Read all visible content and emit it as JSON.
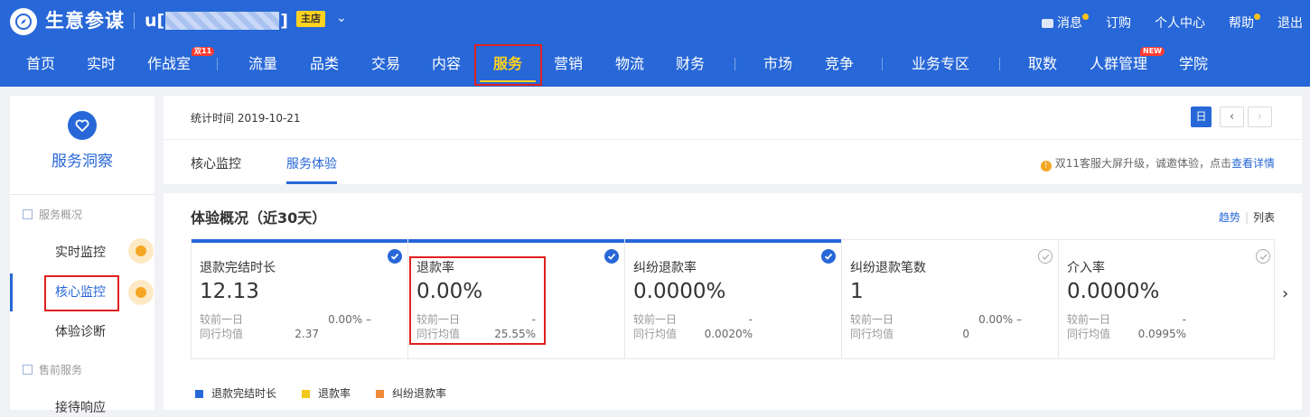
{
  "header": {
    "brand": "生意参谋",
    "shop_prefix": "u[",
    "shop_suffix": "]",
    "main_badge": "主店",
    "links": [
      "消息",
      "订购",
      "个人中心",
      "帮助",
      "退出"
    ]
  },
  "nav": {
    "items": [
      "首页",
      "实时",
      "作战室",
      "流量",
      "品类",
      "交易",
      "内容",
      "服务",
      "营销",
      "物流",
      "财务",
      "市场",
      "竞争",
      "业务专区",
      "取数",
      "人群管理",
      "学院"
    ],
    "active": "服务",
    "tag_double11": "双11",
    "tag_new": "NEW"
  },
  "sidebar": {
    "title": "服务洞察",
    "section1": "服务概况",
    "items1": [
      "实时监控",
      "核心监控",
      "体验诊断"
    ],
    "section2": "售前服务",
    "items2": [
      "接待响应"
    ]
  },
  "toolbar": {
    "stat_time": "统计时间 2019-10-21",
    "day_button": "日",
    "prev": "‹",
    "next": "›"
  },
  "tabs": [
    "核心监控",
    "服务体验"
  ],
  "notice": {
    "text": "双11客服大屏升级，诚邀体验，点击",
    "link": "查看详情"
  },
  "overview": {
    "title": "体验概况（近30天）",
    "view_trend": "趋势",
    "view_list": "列表",
    "cards": [
      {
        "name": "退款完结时长",
        "value": "12.13",
        "row1_label": "较前一日",
        "row1_value": "0.00% –",
        "row2_label": "同行均值",
        "row2_value": "2.37",
        "checked": true
      },
      {
        "name": "退款率",
        "value": "0.00%",
        "row1_label": "较前一日",
        "row1_value": "-",
        "row2_label": "同行均值",
        "row2_value": "25.55%",
        "checked": true
      },
      {
        "name": "纠纷退款率",
        "value": "0.0000%",
        "row1_label": "较前一日",
        "row1_value": "-",
        "row2_label": "同行均值",
        "row2_value": "0.0020%",
        "checked": true
      },
      {
        "name": "纠纷退款笔数",
        "value": "1",
        "row1_label": "较前一日",
        "row1_value": "0.00% –",
        "row2_label": "同行均值",
        "row2_value": "0",
        "checked": false
      },
      {
        "name": "介入率",
        "value": "0.0000%",
        "row1_label": "较前一日",
        "row1_value": "-",
        "row2_label": "同行均值",
        "row2_value": "0.0995%",
        "checked": false
      }
    ],
    "next_arrow": "›",
    "legend": [
      {
        "label": "退款完结时长",
        "color": "#2767d7"
      },
      {
        "label": "退款率",
        "color": "#f2c81b"
      },
      {
        "label": "纠纷退款率",
        "color": "#f08c3a"
      }
    ]
  },
  "colors": {
    "primary": "#2767d7",
    "highlight": "#ffd21f",
    "annotation": "#e02020"
  }
}
